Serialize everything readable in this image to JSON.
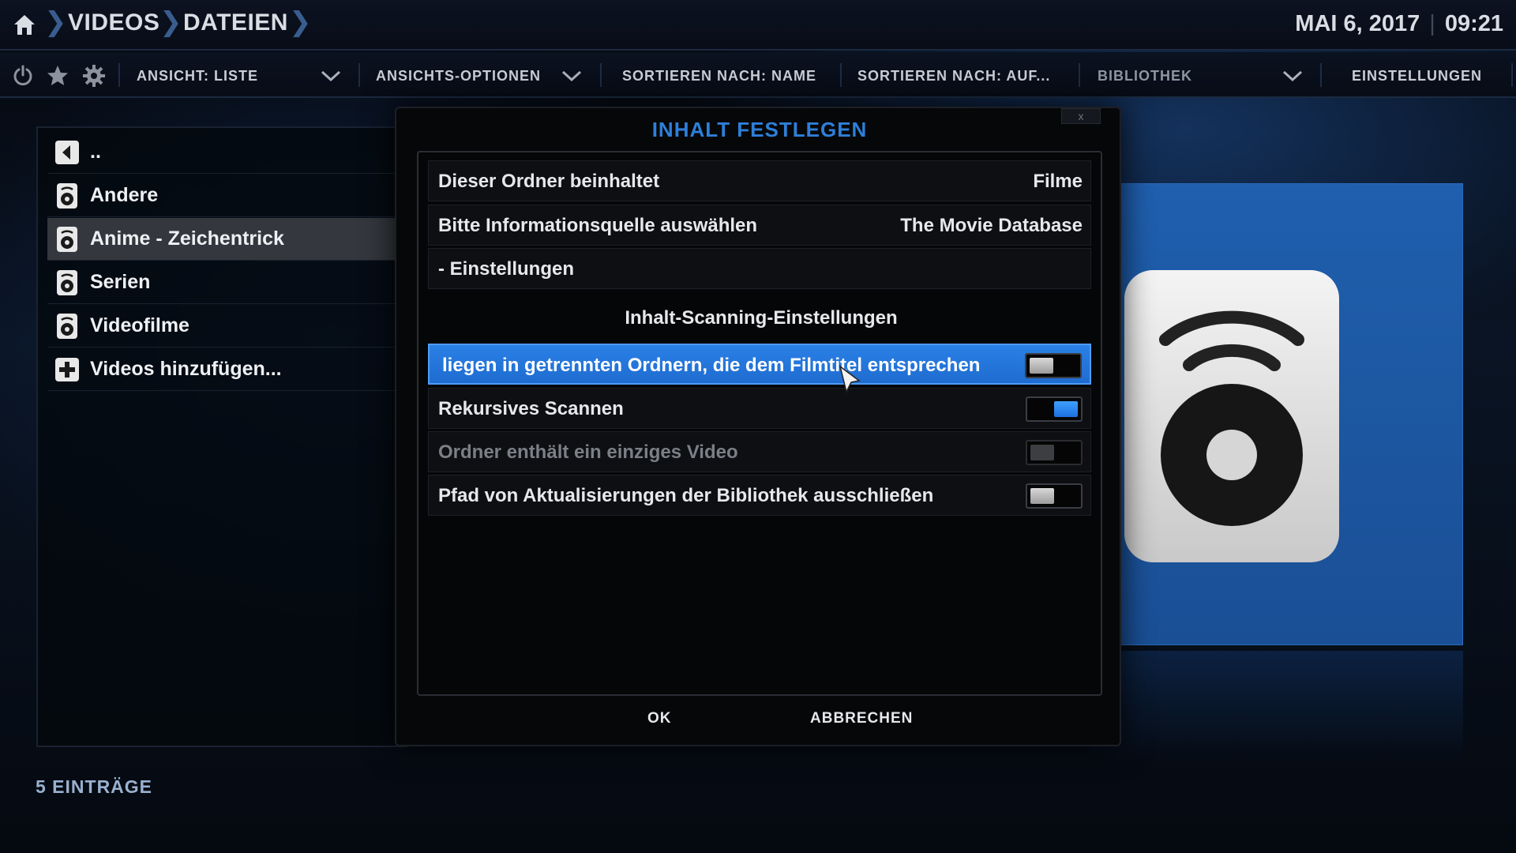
{
  "header": {
    "breadcrumb": [
      "VIDEOS",
      "DATEIEN"
    ],
    "date": "MAI 6, 2017",
    "time": "09:21"
  },
  "toolbar": {
    "view_label": "ANSICHT: LISTE",
    "view_options_label": "ANSICHTS-OPTIONEN",
    "sort_by_label": "SORTIEREN NACH: NAME",
    "sort_order_label": "SORTIEREN NACH: AUF...",
    "library_label": "BIBLIOTHEK",
    "settings_label": "EINSTELLUNGEN"
  },
  "sources": {
    "items": [
      {
        "label": "..",
        "icon": "back-icon"
      },
      {
        "label": "Andere",
        "icon": "drive-icon"
      },
      {
        "label": "Anime - Zeichentrick",
        "icon": "drive-icon",
        "selected": true
      },
      {
        "label": "Serien",
        "icon": "drive-icon"
      },
      {
        "label": "Videofilme",
        "icon": "drive-icon"
      },
      {
        "label": "Videos hinzufügen...",
        "icon": "add-icon"
      }
    ],
    "count_label": "5 EINTRÄGE"
  },
  "dialog": {
    "title": "INHALT FESTLEGEN",
    "close_label": "x",
    "content_type_label": "Dieser Ordner beinhaltet",
    "content_type_value": "Filme",
    "scraper_label": "Bitte Informationsquelle auswählen",
    "scraper_value": "The Movie Database",
    "settings_label": "- Einstellungen",
    "scanning_section": "Inhalt-Scanning-Einstellungen",
    "options": [
      {
        "label": "liegen in getrennten Ordnern, die dem Filmtitel entsprechen",
        "enabled": false,
        "focused": true
      },
      {
        "label": "Rekursives Scannen",
        "enabled": true
      },
      {
        "label": "Ordner enthält ein einziges Video",
        "enabled": false,
        "disabled": true
      },
      {
        "label": "Pfad von Aktualisierungen der Bibliothek ausschließen",
        "enabled": false
      }
    ],
    "ok_label": "OK",
    "cancel_label": "ABBRECHEN"
  },
  "colors": {
    "accent": "#2a80e6",
    "title": "#2d7fd9",
    "preview_bg": "#1f5fae"
  }
}
